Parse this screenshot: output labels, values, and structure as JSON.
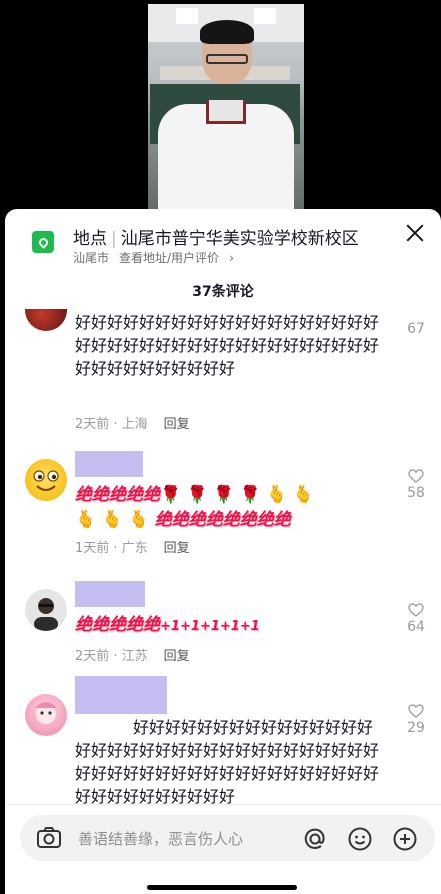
{
  "location": {
    "label": "地点",
    "name": "汕尾市普宁华美实验学校新校区",
    "city": "汕尾市",
    "link": "查看地址/用户评价",
    "brand_color": "#1fba4e"
  },
  "comment_count": "37条评论",
  "comments": [
    {
      "text": "好好好好好好好好好好好好好好好好好好好好好好好好好好好好好好好好好好好好好好好好好好好好好好好好",
      "time": "2天前 · 上海",
      "reply": "回复",
      "likes": "67"
    },
    {
      "text_a": "绝绝绝绝绝",
      "text_b": "绝绝绝绝绝绝绝绝",
      "time": "1天前 · 广东",
      "reply": "回复",
      "likes": "58"
    },
    {
      "text_a": "绝绝绝绝绝",
      "text_b": "+1+1+1+1+1",
      "time": "2天前 · 江苏",
      "reply": "回复",
      "likes": "64"
    },
    {
      "text": "好好好好好好好好好好好好好好好好好好好好好好好好好好好好好好好好好好好好好好好好好好好好好好好好好好好好好好好好好好好好好好好",
      "likes": "29"
    }
  ],
  "input": {
    "placeholder": "善语结善缘，恶言伤人心"
  },
  "colors": {
    "accent_red": "#e8154a",
    "name_placeholder": "#c5bef0"
  }
}
